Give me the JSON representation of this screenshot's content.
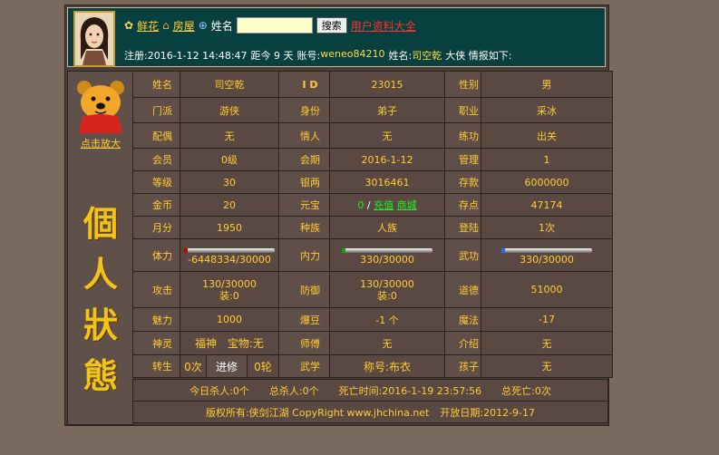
{
  "header": {
    "flower_link": "鲜花",
    "house_link": "房屋",
    "name_label": "姓名",
    "search_value": "",
    "search_button": "搜索",
    "user_data_link": "用户资料大全",
    "register_info": "注册:2016-1-12 14:48:47",
    "days_ago": "距今 9 天",
    "account_label": "账号:",
    "account_value": "weneo84210",
    "name_prefix": "姓名:",
    "name_value": "司空乾",
    "suffix": "大侠 情报如下:"
  },
  "sidebar": {
    "enlarge": "点击放大",
    "title_chars": [
      "個",
      "人",
      "狀",
      "態"
    ]
  },
  "stats": {
    "name_label": "姓名",
    "name": "司空乾",
    "id_label": "I D",
    "id": "23015",
    "gender_label": "性别",
    "gender": "男",
    "sect_label": "门派",
    "sect": "游侠",
    "status_label": "身份",
    "status": "弟子",
    "job_label": "职业",
    "job": "采冰",
    "spouse_label": "配偶",
    "spouse": "无",
    "lover_label": "情人",
    "lover": "无",
    "training_label": "练功",
    "training": "出关",
    "member_label": "会员",
    "member": "0级",
    "period_label": "会期",
    "period": "2016-1-12",
    "admin_label": "管理",
    "admin": "1",
    "level_label": "等级",
    "level": "30",
    "silver_label": "银两",
    "silver": "3016461",
    "deposit_label": "存款",
    "deposit": "6000000",
    "gold_label": "金币",
    "gold": "20",
    "yuanbao_label": "元宝",
    "yuanbao": "0",
    "yuanbao_sep": "/",
    "recharge_link": "充值",
    "shop_link": "商城",
    "savepoint_label": "存点",
    "savepoint": "47174",
    "month_label": "月分",
    "month": "1950",
    "race_label": "种族",
    "race": "人族",
    "login_label": "登陆",
    "login": "1次",
    "hp_label": "体力",
    "hp": "-6448334/30000",
    "mp_label": "内力",
    "mp": "330/30000",
    "martial_label": "武功",
    "martial": "330/30000",
    "attack_label": "攻击",
    "attack": "130/30000",
    "attack_equip": "装:0",
    "defense_label": "防御",
    "defense": "130/30000",
    "defense_equip": "装:0",
    "morality_label": "道德",
    "morality": "51000",
    "charm_label": "魅力",
    "charm": "1000",
    "beans_label": "爆豆",
    "beans": "-1 个",
    "magic_label": "魔法",
    "magic": "-17",
    "spirit_label": "神灵",
    "spirit": "福神",
    "treasure": "宝物:无",
    "master_label": "师傅",
    "master": "无",
    "intro_label": "介绍",
    "intro": "无",
    "rebirth_label": "转生",
    "rebirth": "0次",
    "advance_label": "进修",
    "advance": "0轮",
    "wuxue_label": "武学",
    "title": "称号:布衣",
    "child_label": "孩子",
    "child": "无"
  },
  "footer": {
    "kills_today": "今日杀人:0个",
    "kills_total": "总杀人:0个",
    "death_time": "死亡时间:2016-1-19 23:57:56",
    "deaths_total": "总死亡:0次",
    "copyright": "版权所有:侠剑江湖 CopyRight www.jhchina.net",
    "open_date": "开放日期:2012-9-17"
  }
}
